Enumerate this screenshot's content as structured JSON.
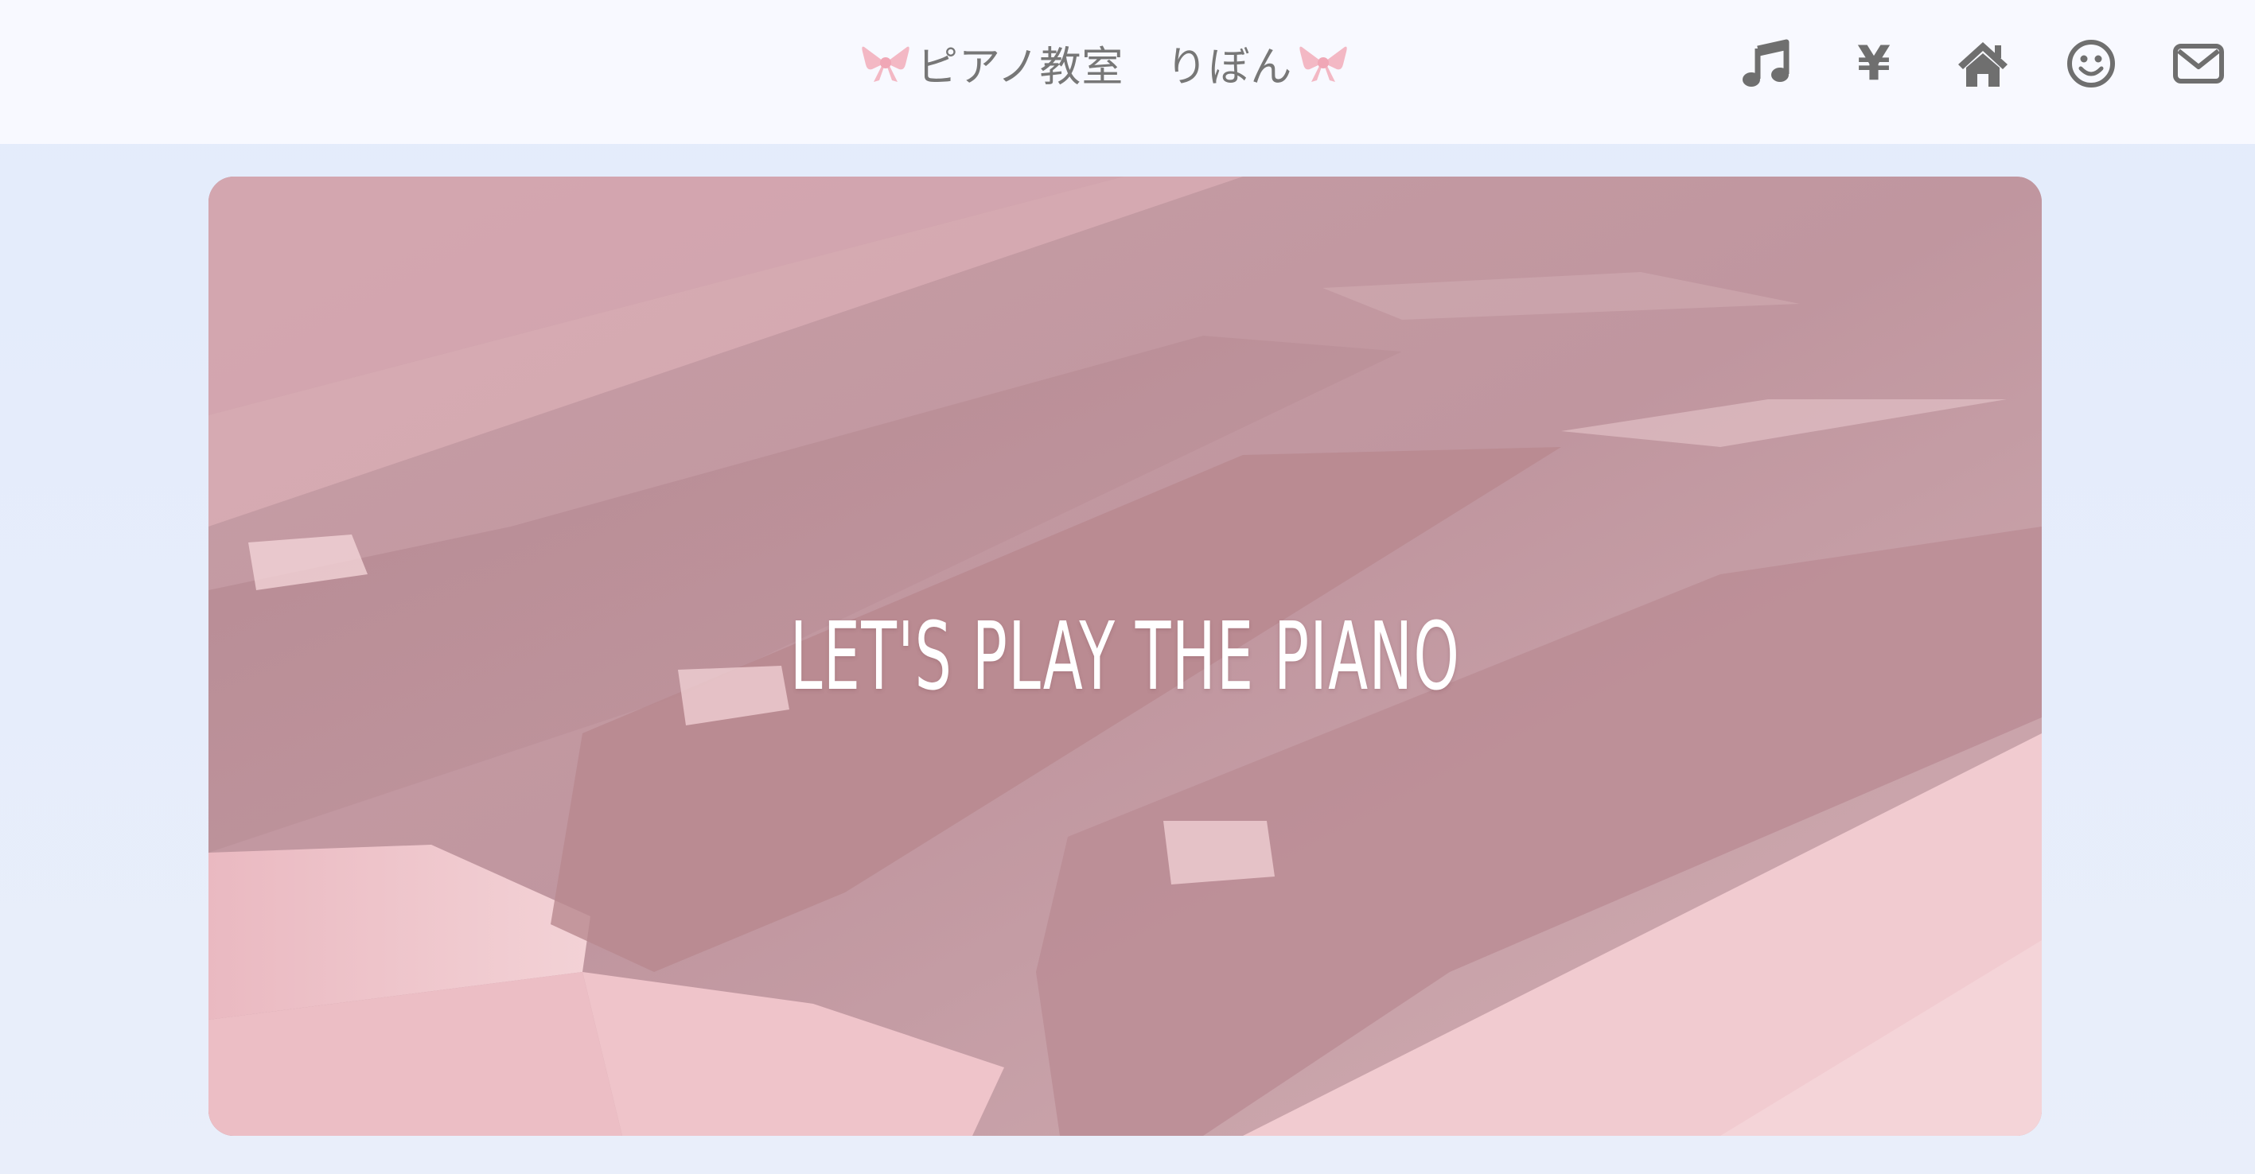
{
  "header": {
    "title": "ピアノ教室　りぼん",
    "bow_icon": "ribbon-bow-icon",
    "nav_items": [
      {
        "icon": "music-note-icon",
        "label": "♫"
      },
      {
        "icon": "yen-icon",
        "label": "¥"
      },
      {
        "icon": "home-icon",
        "label": ""
      },
      {
        "icon": "smiley-icon",
        "label": ""
      },
      {
        "icon": "mail-icon",
        "label": ""
      }
    ]
  },
  "hero": {
    "headline": "LET'S PLAY THE PIANO",
    "image": "pink-tinted-piano-keys-photo"
  },
  "colors": {
    "header_bg": "#f8f9ff",
    "page_bg": "#e4ecfb",
    "title_text": "#777777",
    "icon": "#6f6f6f",
    "bow": "#f3b8c4",
    "hero_overlay": "#c49aa3",
    "hero_text": "#ffffff"
  }
}
